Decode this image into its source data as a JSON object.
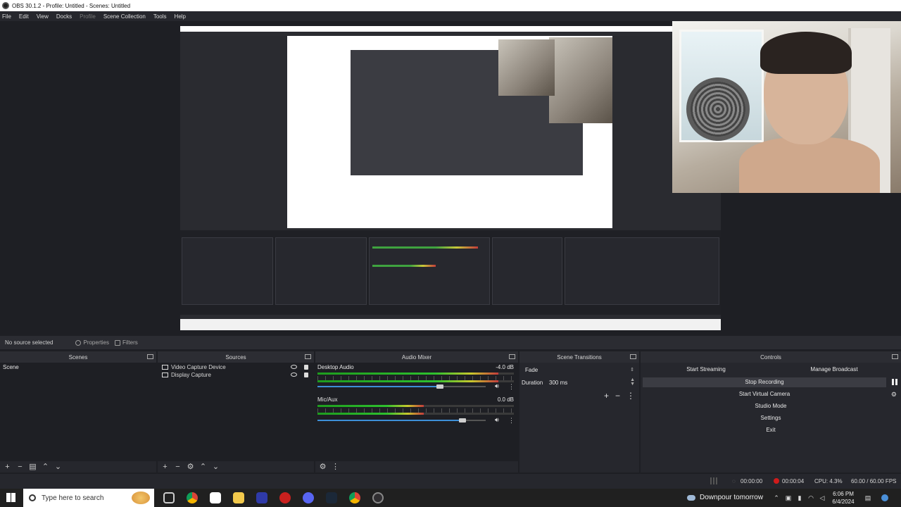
{
  "window": {
    "title": "OBS 30.1.2 - Profile: Untitled - Scenes: Untitled"
  },
  "menu": [
    {
      "label": "File",
      "enabled": true
    },
    {
      "label": "Edit",
      "enabled": true
    },
    {
      "label": "View",
      "enabled": true
    },
    {
      "label": "Docks",
      "enabled": true
    },
    {
      "label": "Profile",
      "enabled": false
    },
    {
      "label": "Scene Collection",
      "enabled": true
    },
    {
      "label": "Tools",
      "enabled": true
    },
    {
      "label": "Help",
      "enabled": true
    }
  ],
  "source_bar": {
    "status": "No source selected",
    "properties": "Properties",
    "filters": "Filters"
  },
  "scenes": {
    "title": "Scenes",
    "items": [
      "Scene"
    ]
  },
  "sources": {
    "title": "Sources",
    "items": [
      "Video Capture Device",
      "Display Capture"
    ]
  },
  "mixer": {
    "title": "Audio Mixer",
    "channels": [
      {
        "name": "Desktop Audio",
        "db": "-4.0 dB",
        "level": 0.92,
        "volume": 0.73
      },
      {
        "name": "Mic/Aux",
        "db": "0.0 dB",
        "level": 0.54,
        "volume": 0.86
      }
    ]
  },
  "transitions": {
    "title": "Scene Transitions",
    "selected": "Fade",
    "duration_label": "Duration",
    "duration_value": "300 ms"
  },
  "controls": {
    "title": "Controls",
    "start_streaming": "Start Streaming",
    "manage_broadcast": "Manage Broadcast",
    "stop_recording": "Stop Recording",
    "start_virtual_camera": "Start Virtual Camera",
    "studio_mode": "Studio Mode",
    "settings": "Settings",
    "exit": "Exit"
  },
  "status": {
    "stream_time": "00:00:00",
    "record_time": "00:00:04",
    "cpu": "CPU: 4.3%",
    "fps": "60.00 / 60.00 FPS"
  },
  "taskbar": {
    "search_placeholder": "Type here to search",
    "weather": "Downpour tomorrow",
    "time": "6:06 PM",
    "date": "6/4/2024"
  },
  "colors": {
    "accent_blue": "#3d8fd8",
    "record_red": "#d01b1b",
    "meter_green": "#2ec02e"
  }
}
